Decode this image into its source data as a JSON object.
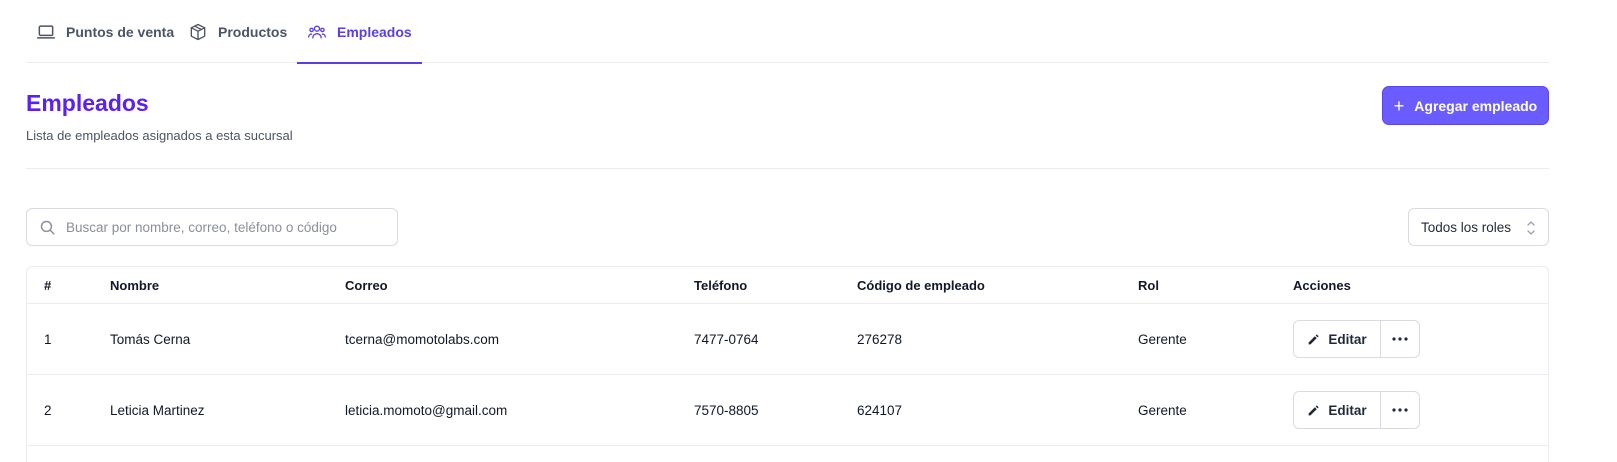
{
  "tabs": [
    {
      "label": "Puntos de venta",
      "icon": "laptop-icon"
    },
    {
      "label": "Productos",
      "icon": "box-icon"
    },
    {
      "label": "Empleados",
      "icon": "users-icon",
      "active": true
    }
  ],
  "header": {
    "title": "Empleados",
    "subtitle": "Lista de empleados asignados a esta sucursal",
    "add_button": "Agregar empleado"
  },
  "search": {
    "placeholder": "Buscar por nombre, correo, teléfono o código",
    "value": ""
  },
  "role_filter": {
    "selected": "Todos los roles"
  },
  "table": {
    "columns": [
      "#",
      "Nombre",
      "Correo",
      "Teléfono",
      "Código de empleado",
      "Rol",
      "Acciones"
    ],
    "rows": [
      {
        "num": "1",
        "name": "Tomás Cerna",
        "email": "tcerna@momotolabs.com",
        "phone": "7477-0764",
        "code": "276278",
        "role": "Gerente",
        "edit": "Editar"
      },
      {
        "num": "2",
        "name": "Leticia Martinez",
        "email": "leticia.momoto@gmail.com",
        "phone": "7570-8805",
        "code": "624107",
        "role": "Gerente",
        "edit": "Editar"
      }
    ]
  },
  "colors": {
    "accent": "#5b3fe0",
    "title": "#5b21f3",
    "button": "#6b5cff"
  }
}
